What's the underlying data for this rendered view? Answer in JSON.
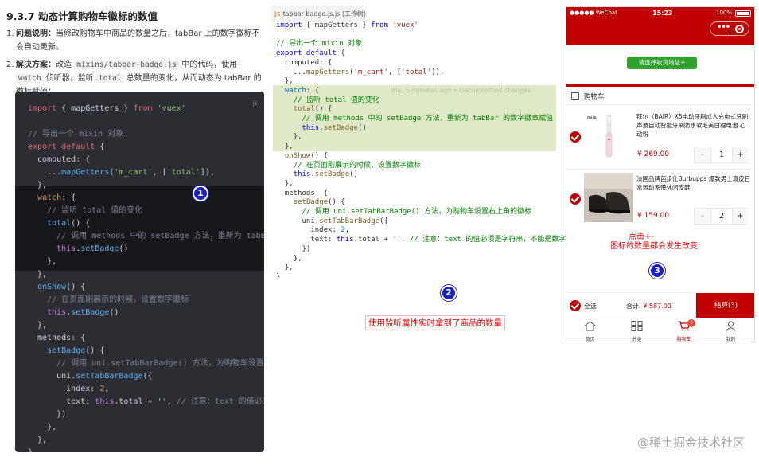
{
  "doc": {
    "title": "9.3.7 动态计算购物车徽标的数值",
    "item1": {
      "num": "1.",
      "label": "问题说明：",
      "text": "当修改购物车中商品的数量之后，tabBar 上的数字徽标不会自动更新。"
    },
    "item2": {
      "num": "2.",
      "label": "解决方案：",
      "t1": "改造 ",
      "c1": "mixins/tabbar-badge.js",
      "t2": " 中的代码，使用 ",
      "c2": "watch",
      "t3": " 侦听器，监听 ",
      "c3": "total",
      "t4": " 总数量的变化，从而动态为 tabBar 的徽标赋值："
    },
    "code_lang": "js"
  },
  "editor": {
    "tab_icon": "JS",
    "tab_label": "tabbar-badge.js.js (工作树)",
    "blame": "You, 5 minutes ago • Uncommitted changes"
  },
  "phone": {
    "status_left": "●●●●● WeChat",
    "status_time": "15:23",
    "status_right": "100%",
    "address_button": "请选择收货地址+",
    "cart_title": "购物车",
    "items": [
      {
        "name": "拜尔（BAIR）X5电动牙刷成人充电式牙刷声波自动智能牙刷防水软毛美白锂电池 心动粉",
        "price": "¥ 269.00",
        "qty": "1",
        "minus": "-",
        "plus": "+"
      },
      {
        "name": "法国品牌芭步仕Burbupps 爆款男士真皮日常运动系带休闲皮鞋",
        "price": "¥ 159.00",
        "qty": "2",
        "minus": "-",
        "plus": "+"
      }
    ],
    "select_all": "全选",
    "total_label": "合计:",
    "total_amount": "¥ 587.00",
    "checkout": "结算(3)",
    "tabs": [
      "首页",
      "分类",
      "购物车",
      "我的"
    ],
    "cart_badge": "3"
  },
  "annotations": {
    "m1": "1",
    "m2": "2",
    "m3": "3",
    "note2": "使用监听属性实时拿到了商品的数量",
    "note3a": "点击+-",
    "note3b": "图标的数量都会发生改变"
  },
  "watermark": "@稀土掘金技术社区",
  "colors": {
    "accent": "#c00000",
    "marker": "#1a20c4",
    "annotation": "#e00000",
    "address_button": "#2ea12f",
    "watch_highlight": "#dfe9c8"
  }
}
